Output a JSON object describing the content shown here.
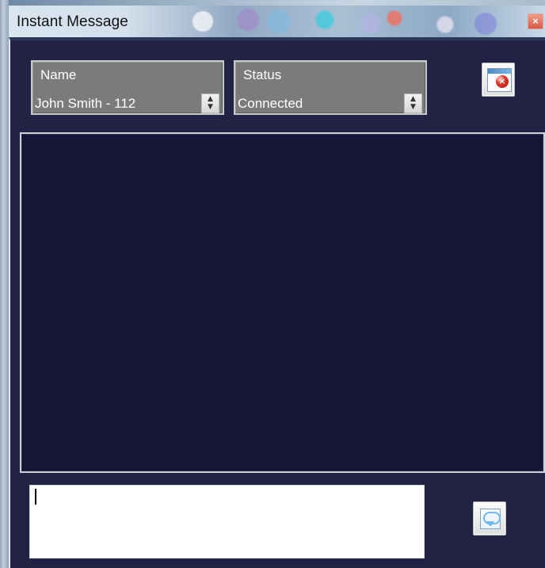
{
  "window": {
    "title": "Instant Message",
    "close_symbol": "×"
  },
  "contact": {
    "name_label": "Name",
    "name_value": "John Smith - 112",
    "status_label": "Status",
    "status_value": "Connected"
  },
  "controls": {
    "spin_up_symbol": "▲",
    "spin_down_symbol": "▼",
    "close_chat_badge_symbol": "×"
  },
  "chat": {
    "history": ""
  },
  "message": {
    "value": "",
    "placeholder": ""
  },
  "icons": {
    "window_close": "close-icon",
    "close_chat": "window-close-icon",
    "send": "send-message-icon",
    "spin_up": "chevron-up-icon",
    "spin_down": "chevron-down-icon"
  },
  "colors": {
    "window_background": "#222245",
    "chat_background": "#151535",
    "field_background": "#7b7b7b",
    "field_text": "#ffffff",
    "titlebar_text": "#111111",
    "alert_red": "#d32522",
    "send_blue": "#6eb8ef"
  }
}
